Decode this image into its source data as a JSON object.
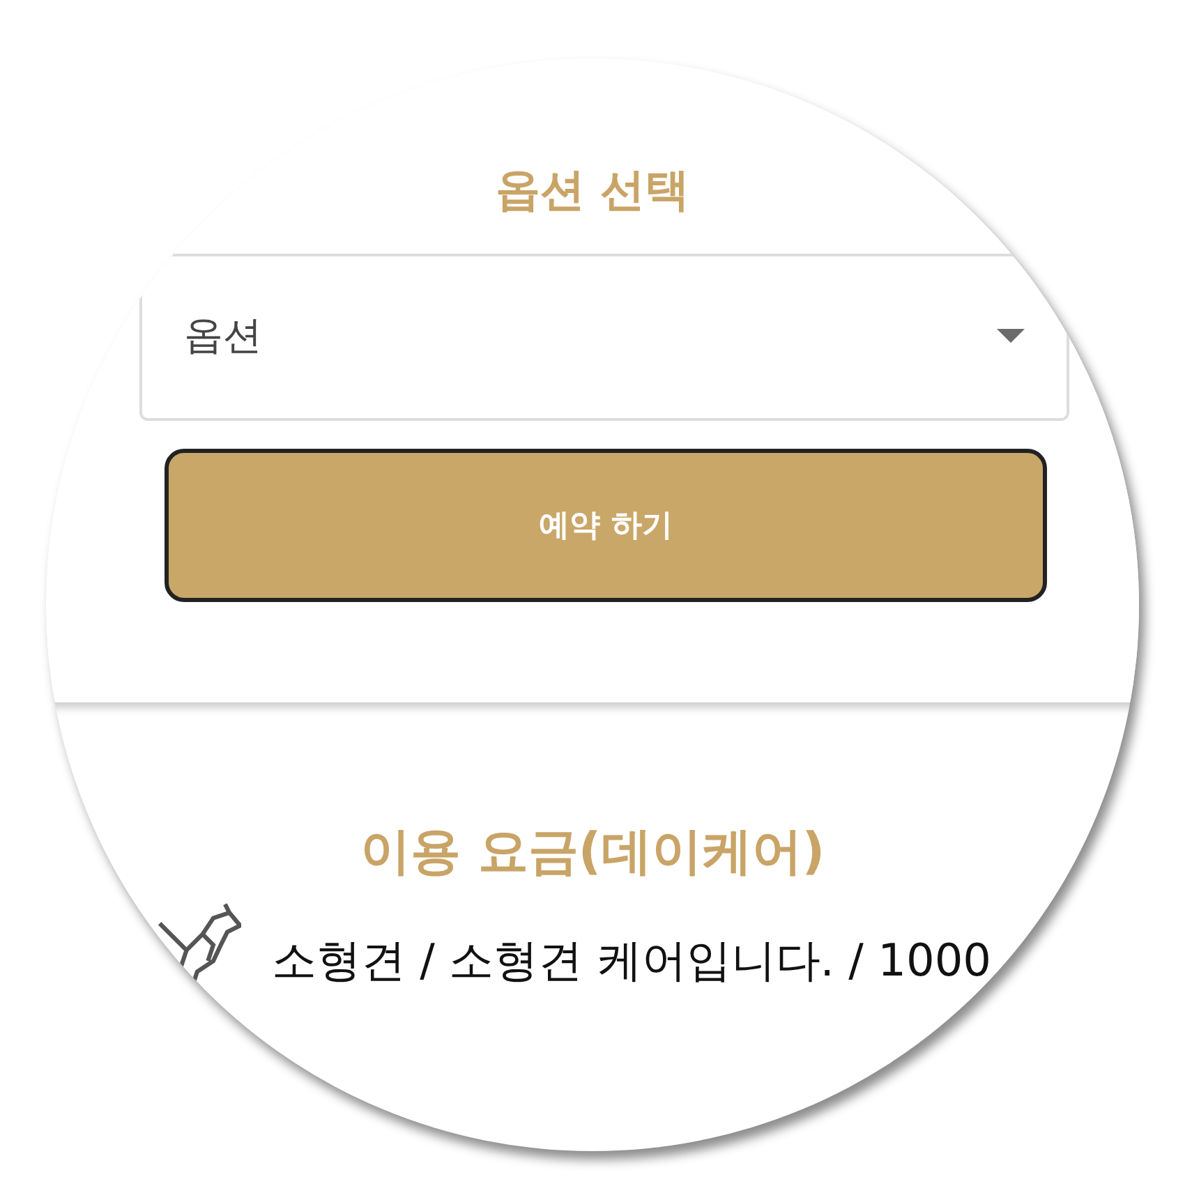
{
  "option_section": {
    "title": "옵션 선택",
    "select": {
      "value": "옵션"
    },
    "reserve_button": "예약 하기"
  },
  "pricing_section": {
    "title": "이용 요금(데이케어)",
    "items": [
      {
        "text": "소형견 / 소형견 케어입니다. / 1000"
      }
    ]
  }
}
